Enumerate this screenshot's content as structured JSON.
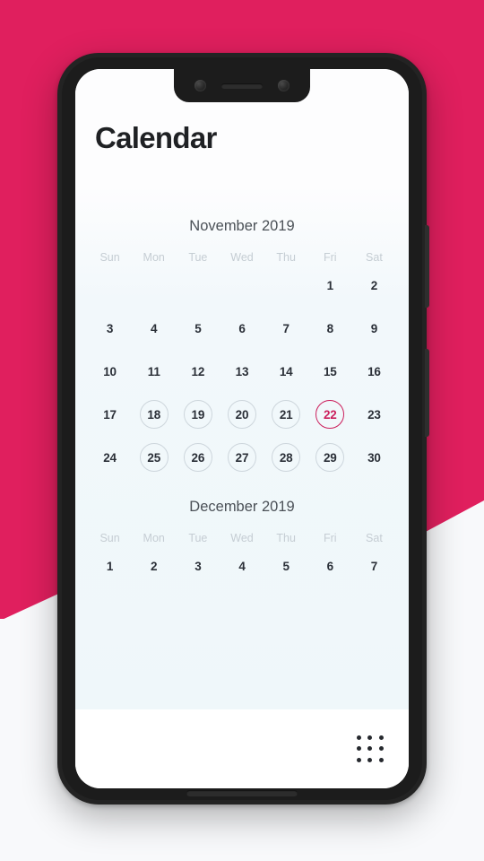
{
  "app": {
    "title": "Calendar"
  },
  "device": {
    "notch": {
      "camera_left_icon": "camera-lens-icon",
      "speaker_icon": "earpiece-speaker-icon",
      "camera_right_icon": "camera-lens-icon"
    },
    "buttons": {
      "power_label": "Power",
      "volume_label": "Volume"
    },
    "bottom_speaker_label": "Speaker grille"
  },
  "calendar": {
    "weekdays": [
      "Sun",
      "Mon",
      "Tue",
      "Wed",
      "Thu",
      "Fri",
      "Sat"
    ],
    "months": [
      {
        "title": "November 2019",
        "weeks": [
          [
            {
              "label": "",
              "state": "empty"
            },
            {
              "label": "",
              "state": "empty"
            },
            {
              "label": "",
              "state": "empty"
            },
            {
              "label": "",
              "state": "empty"
            },
            {
              "label": "",
              "state": "empty"
            },
            {
              "label": "1",
              "state": "plain"
            },
            {
              "label": "2",
              "state": "plain"
            }
          ],
          [
            {
              "label": "3",
              "state": "plain"
            },
            {
              "label": "4",
              "state": "plain"
            },
            {
              "label": "5",
              "state": "plain"
            },
            {
              "label": "6",
              "state": "plain"
            },
            {
              "label": "7",
              "state": "plain"
            },
            {
              "label": "8",
              "state": "plain"
            },
            {
              "label": "9",
              "state": "plain"
            }
          ],
          [
            {
              "label": "10",
              "state": "plain"
            },
            {
              "label": "11",
              "state": "plain"
            },
            {
              "label": "12",
              "state": "plain"
            },
            {
              "label": "13",
              "state": "plain"
            },
            {
              "label": "14",
              "state": "plain"
            },
            {
              "label": "15",
              "state": "plain"
            },
            {
              "label": "16",
              "state": "plain"
            }
          ],
          [
            {
              "label": "17",
              "state": "plain"
            },
            {
              "label": "18",
              "state": "ringed"
            },
            {
              "label": "19",
              "state": "ringed"
            },
            {
              "label": "20",
              "state": "ringed"
            },
            {
              "label": "21",
              "state": "ringed"
            },
            {
              "label": "22",
              "state": "selected"
            },
            {
              "label": "23",
              "state": "plain"
            }
          ],
          [
            {
              "label": "24",
              "state": "plain"
            },
            {
              "label": "25",
              "state": "ringed"
            },
            {
              "label": "26",
              "state": "ringed"
            },
            {
              "label": "27",
              "state": "ringed"
            },
            {
              "label": "28",
              "state": "ringed"
            },
            {
              "label": "29",
              "state": "ringed"
            },
            {
              "label": "30",
              "state": "plain"
            }
          ]
        ]
      },
      {
        "title": "December 2019",
        "weeks": [
          [
            {
              "label": "1",
              "state": "plain"
            },
            {
              "label": "2",
              "state": "plain"
            },
            {
              "label": "3",
              "state": "plain"
            },
            {
              "label": "4",
              "state": "plain"
            },
            {
              "label": "5",
              "state": "plain"
            },
            {
              "label": "6",
              "state": "plain"
            },
            {
              "label": "7",
              "state": "plain"
            }
          ]
        ]
      }
    ]
  },
  "bottom_bar": {
    "grid_menu_icon": "apps-grid-icon"
  },
  "colors": {
    "backdrop_pink": "#e01f5e",
    "backdrop_white": "#f8f9fb",
    "selected_day": "#cb1f5c",
    "ring": "#cdd6dc",
    "day_text": "#2b3038",
    "weekday_text": "#c5cdd3",
    "month_title": "#4b5157",
    "title_text": "#1f2124"
  }
}
